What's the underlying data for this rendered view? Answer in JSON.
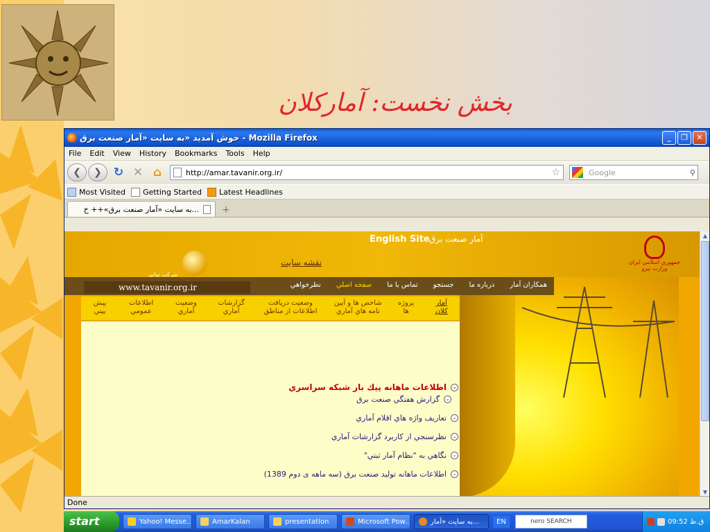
{
  "slide": {
    "title": "بخش نخست: آمارکلان"
  },
  "window": {
    "title": "خوش آمدید «به سایت «آمار صنعت برق - Mozilla Firefox",
    "controls": {
      "minimize": "_",
      "maximize": "❐",
      "close": "✕"
    }
  },
  "menu": [
    "File",
    "Edit",
    "View",
    "History",
    "Bookmarks",
    "Tools",
    "Help"
  ],
  "nav": {
    "url": "http://amar.tavanir.org.ir/",
    "search_placeholder": "Google"
  },
  "bookmarks": [
    "Most Visited",
    "Getting Started",
    "Latest Headlines"
  ],
  "tab": {
    "label": "...به سایت «آمار صنعت برق»++ خ",
    "new_tab": "+"
  },
  "site": {
    "english_link": "English Site",
    "site_name": "آمار صنعت برق",
    "site_map": "نقشه سایت",
    "company": "شرکت توانير",
    "url_text": "www.tavanir.org.ir",
    "emblem_line1": "جمهوري اسلامي ايران",
    "emblem_line2": "وزارت نيرو",
    "nav_main": [
      "همكاران آمار",
      "درباره ما",
      "جستجو",
      "تماس با ما",
      "صفحه اصلي",
      "نظرخواهي"
    ],
    "nav_sub": [
      "آمار كلان",
      "پروژه ها",
      "شاخص ها و آيين نامه هاي آماري",
      "وضعيت دريافت اطلاعات از مناطق",
      "گزارشات آماري",
      "وضعيت آماري",
      "اطلاعات عمومي",
      "پيش بيني"
    ],
    "list": [
      "اطلاعات ماهانه پيك بار شبكه سراسري",
      "گزارش هفتگي صنعت برق",
      "تعاريف واژه هاي اقلام آماري",
      "نظرسنجي از كاربرد گزارشات آماري",
      "نگاهي به \"نظام آمار ثبتي\"",
      "اطلاعات ماهانه توليد صنعت برق (سه ماهه ی دوم 1389)"
    ]
  },
  "status": "Done",
  "taskbar": {
    "start": "start",
    "tasks": [
      "Yahoo! Messe...",
      "AmarKalan",
      "presentation",
      "Microsoft Pow...",
      "به سایت «آمار..."
    ],
    "lang": "EN",
    "nero": "nero SEARCH",
    "clock": "09:52 ق.ظ"
  },
  "colors": {
    "title_red": "#e0262a",
    "xp_blue": "#245ee0",
    "site_orange": "#f2a600"
  }
}
